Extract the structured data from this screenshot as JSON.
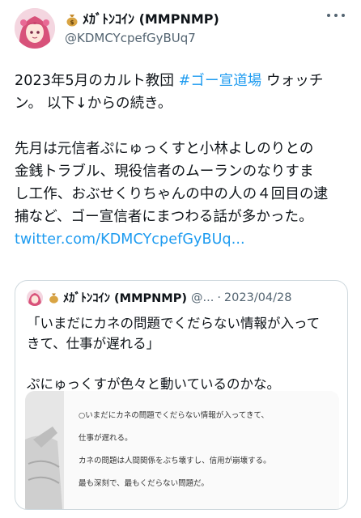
{
  "author": {
    "display_name": "ﾒｶﾞﾄﾝｺｲﾝ (MMPNMP)",
    "handle": "@KDMCYcpefGyBUq7"
  },
  "tweet": {
    "line1_pre": "2023年5月のカルト教団 ",
    "hashtag": "#ゴー宣道場",
    "line1_post": " ウォッチ",
    "line2": "ン。 以下↓からの続き。",
    "line3": "先月は元信者ぷにゅっくすと小林よしのりとの",
    "line4": "金銭トラブル、現役信者のムーランのなりすま",
    "line5": "し工作、おぶせくりちゃんの中の人の４回目の逮",
    "line6": "捕など、ゴー宣信者にまつわる話が多かった。",
    "link": "twitter.com/KDMCYcpefGyBUq..."
  },
  "quote": {
    "display_name": "ﾒｶﾞﾄﾝｺｲﾝ (MMPNMP)",
    "handle": "@...",
    "separator": "·",
    "date": "2023/04/28",
    "line1": "「いまだにカネの問題でくだらない情報が入って",
    "line2": "きて、仕事が遅れる」",
    "line3": "ぷにゅっくすが色々と動いているのかな。",
    "image_lines": [
      "○いまだにカネの問題でくだらない情報が入ってきて、",
      "仕事が遅れる。",
      "カネの問題は人間関係をぶち壊すし、信用が崩壊する。",
      "最も深刻で、最もくだらない問題だ。"
    ]
  }
}
